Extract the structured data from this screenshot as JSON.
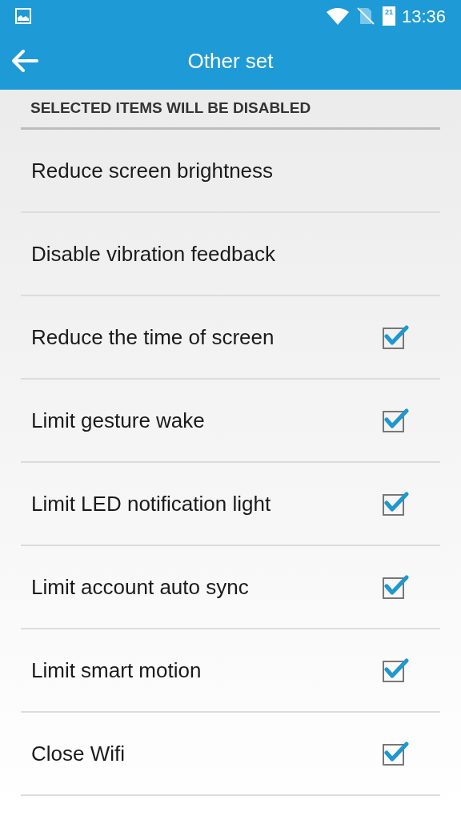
{
  "status_bar": {
    "time": "13:36",
    "battery_level_text": "21"
  },
  "app_bar": {
    "title": "Other set"
  },
  "section": {
    "header": "SELECTED ITEMS WILL BE DISABLED"
  },
  "items": [
    {
      "label": "Reduce screen brightness",
      "kind": "plain"
    },
    {
      "label": "Disable vibration feedback",
      "kind": "plain"
    },
    {
      "label": "Reduce the time of screen",
      "kind": "checkbox",
      "checked": true
    },
    {
      "label": "Limit gesture wake",
      "kind": "checkbox",
      "checked": true
    },
    {
      "label": "Limit LED notification light",
      "kind": "checkbox",
      "checked": true
    },
    {
      "label": "Limit account auto sync",
      "kind": "checkbox",
      "checked": true
    },
    {
      "label": "Limit smart motion",
      "kind": "checkbox",
      "checked": true
    },
    {
      "label": "Close Wifi",
      "kind": "checkbox",
      "checked": true
    }
  ]
}
